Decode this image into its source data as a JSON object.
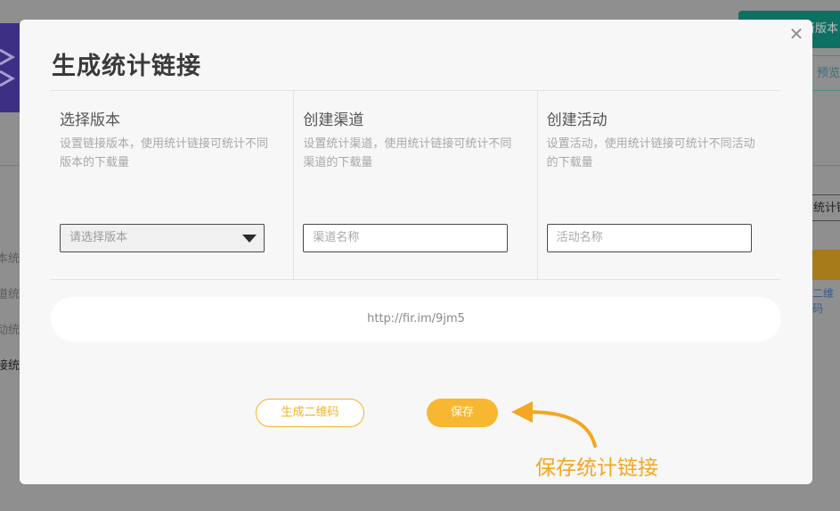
{
  "background": {
    "top_button": "新版本",
    "preview_link": "预览",
    "search_text": "统计链",
    "qr_link": "二维码",
    "left_items": [
      "本统计",
      "道统计",
      "动统计",
      "接统计"
    ]
  },
  "modal": {
    "title": "生成统计链接",
    "close_icon": "close-icon",
    "columns": [
      {
        "title": "选择版本",
        "description": "设置链接版本，使用统计链接可统计不同版本的下载量",
        "control": "select",
        "placeholder": "请选择版本"
      },
      {
        "title": "创建渠道",
        "description": "设置统计渠道，使用统计链接可统计不同渠道的下载量",
        "control": "input",
        "placeholder": "渠道名称"
      },
      {
        "title": "创建活动",
        "description": "设置活动，使用统计链接可统计不同活动的下载量",
        "control": "input",
        "placeholder": "活动名称"
      }
    ],
    "link": "http://fir.im/9jm5",
    "buttons": {
      "qr": "生成二维码",
      "save": "保存"
    },
    "annotation": "保存统计链接",
    "accent_color": "#f7b731"
  }
}
